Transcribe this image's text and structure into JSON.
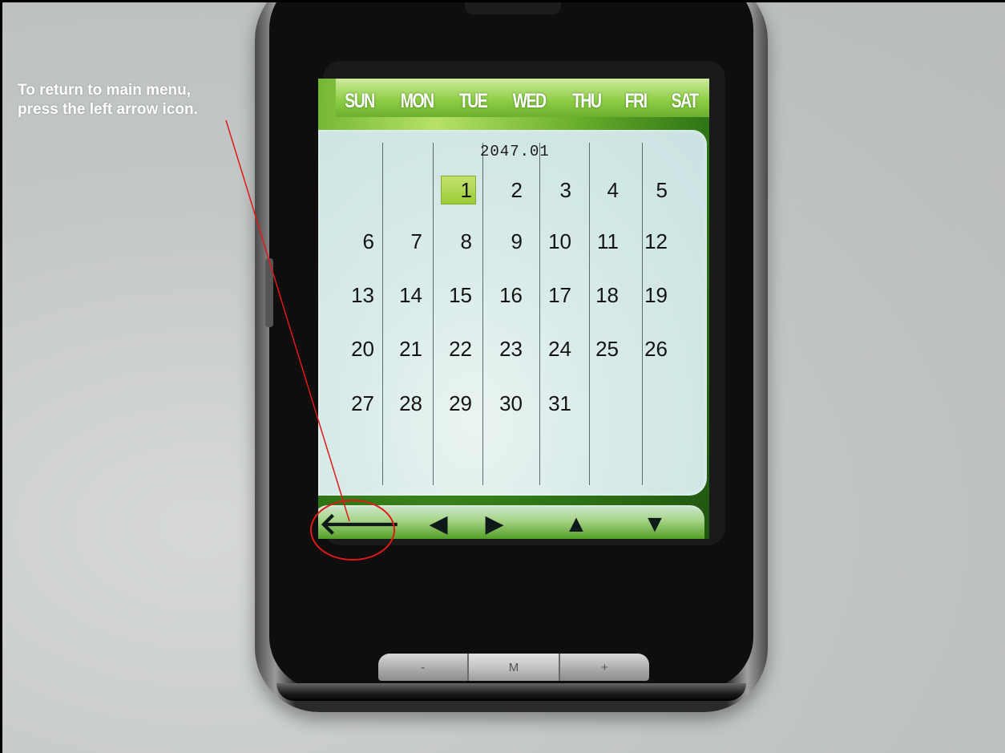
{
  "caption": {
    "line1": "To return to main menu,",
    "line2": "press the left arrow icon."
  },
  "calendar": {
    "weekdays": [
      "SUN",
      "MON",
      "TUE",
      "WED",
      "THU",
      "FRI",
      "SAT"
    ],
    "month_title": "2047.01",
    "selected_day": "1",
    "weeks": [
      [
        "",
        "",
        "1",
        "2",
        "3",
        "4",
        "5"
      ],
      [
        "6",
        "7",
        "8",
        "9",
        "10",
        "11",
        "12"
      ],
      [
        "13",
        "14",
        "15",
        "16",
        "17",
        "18",
        "19"
      ],
      [
        "20",
        "21",
        "22",
        "23",
        "24",
        "25",
        "26"
      ],
      [
        "27",
        "28",
        "29",
        "30",
        "31",
        "",
        ""
      ]
    ]
  },
  "toolbar": {
    "buttons": [
      {
        "name": "back-arrow-icon",
        "glyph": "🡐"
      },
      {
        "name": "triangle-left-icon",
        "glyph": "◀"
      },
      {
        "name": "triangle-right-icon",
        "glyph": "▶"
      },
      {
        "name": "triangle-up-icon",
        "glyph": "▲"
      },
      {
        "name": "triangle-down-icon",
        "glyph": "▼"
      }
    ]
  },
  "hardware_buttons": {
    "minus": "-",
    "menu": "M",
    "plus": "+"
  },
  "colors": {
    "annotation": "#e01818",
    "highlight": "#a8d43e"
  }
}
